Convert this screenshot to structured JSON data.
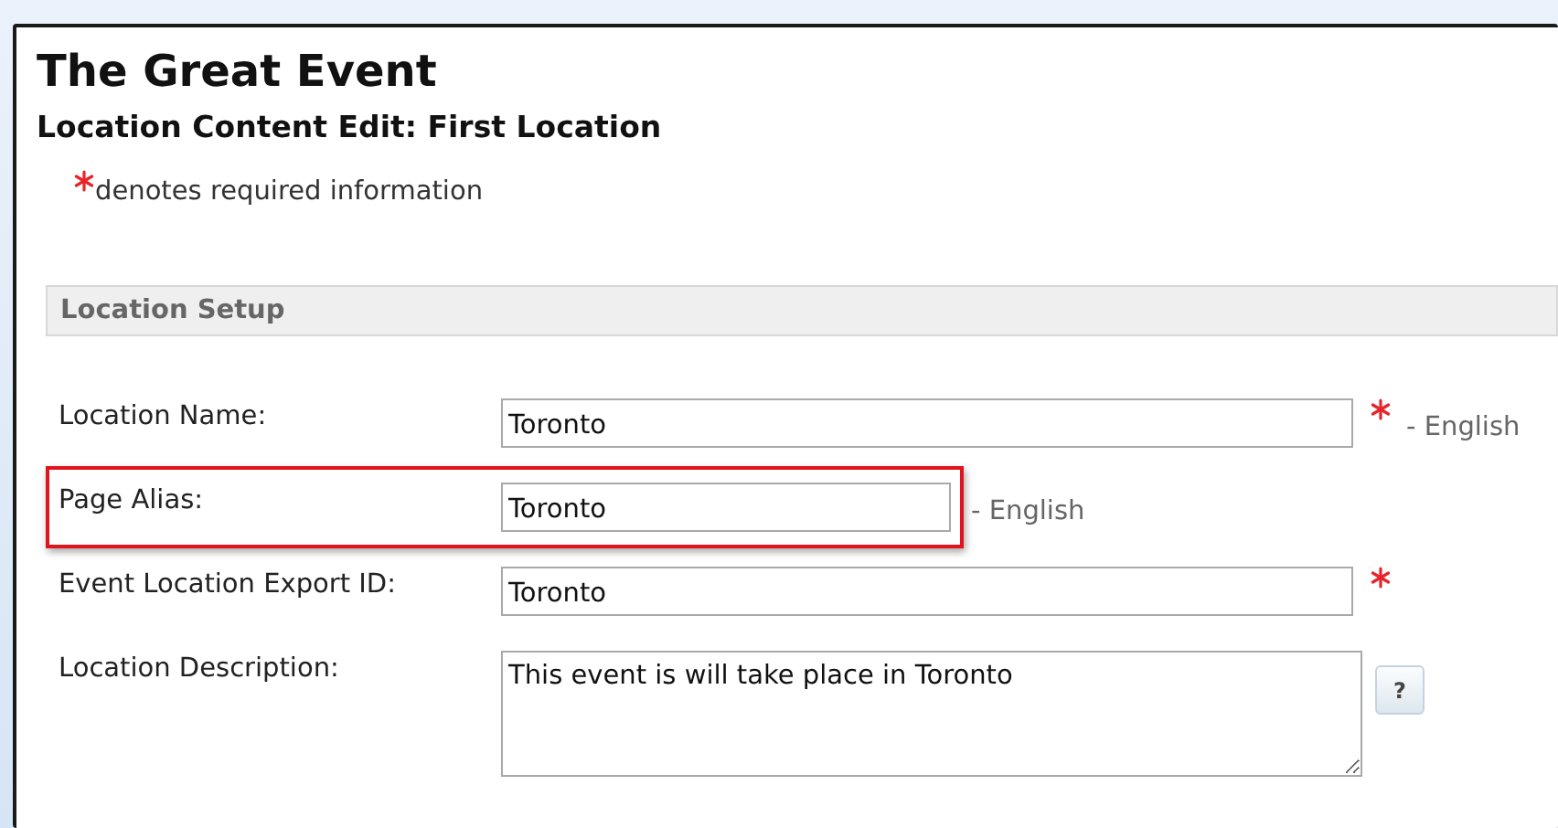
{
  "page": {
    "title": "The Great Event",
    "subtitle": "Location Content Edit: First Location",
    "required_note": "denotes required information"
  },
  "section": {
    "title": "Location Setup"
  },
  "fields": [
    {
      "label": "Location Name:",
      "kind": "text",
      "value": "Toronto",
      "required": true,
      "language": "- English",
      "highlighted": false
    },
    {
      "label": "Page Alias:",
      "kind": "short-text",
      "value": "Toronto",
      "required": false,
      "language": "- English",
      "highlighted": true
    },
    {
      "label": "Event Location Export ID:",
      "kind": "text",
      "value": "Toronto",
      "required": true,
      "highlighted": false
    },
    {
      "label": "Location Description:",
      "kind": "textarea",
      "value": "This event is will take place in Toronto",
      "required": false,
      "highlighted": false,
      "help": "?"
    }
  ]
}
